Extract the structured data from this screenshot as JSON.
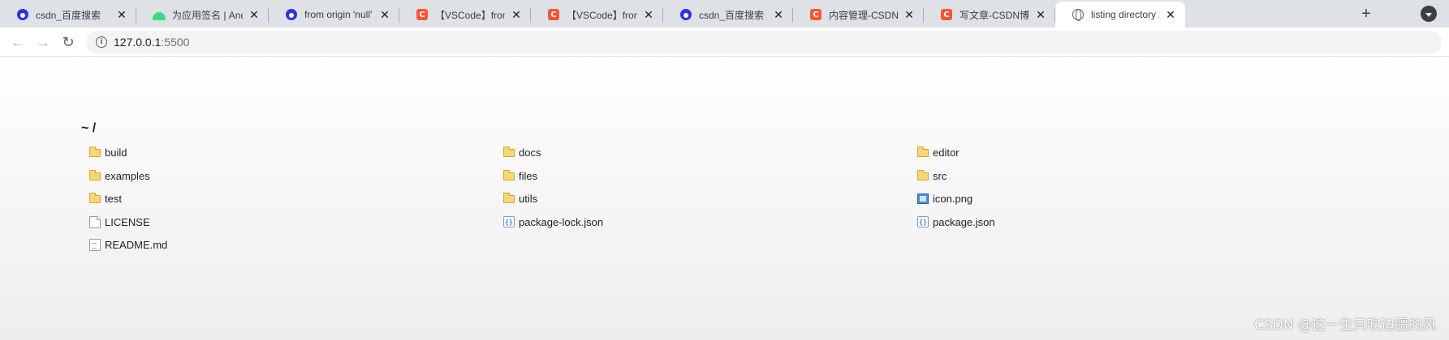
{
  "tabs": [
    {
      "title": "csdn_百度搜索",
      "icon": "baidu-icon"
    },
    {
      "title": "为应用签名 | Android",
      "icon": "android-icon"
    },
    {
      "title": "from origin 'null' has",
      "icon": "baidu-icon"
    },
    {
      "title": "【VSCode】from origin",
      "icon": "csdn-icon"
    },
    {
      "title": "【VSCode】from orig",
      "icon": "csdn-icon"
    },
    {
      "title": "csdn_百度搜索",
      "icon": "baidu-icon"
    },
    {
      "title": "内容管理-CSDN博客",
      "icon": "csdn-icon"
    },
    {
      "title": "写文章-CSDN博客",
      "icon": "csdn-icon"
    },
    {
      "title": "listing directory /",
      "icon": "globe-icon",
      "active": true
    }
  ],
  "tab_close_glyph": "✕",
  "new_tab_glyph": "+",
  "csdn_icon_letter": "C",
  "toolbar": {
    "back_glyph": "←",
    "forward_glyph": "→",
    "reload_glyph": "↻",
    "info_glyph": "i",
    "url_host": "127.0.0.1",
    "url_port": ":5500"
  },
  "listing": {
    "heading": "~ /",
    "columns": [
      [
        {
          "name": "build",
          "type": "folder"
        },
        {
          "name": "examples",
          "type": "folder"
        },
        {
          "name": "test",
          "type": "folder"
        },
        {
          "name": "LICENSE",
          "type": "file"
        },
        {
          "name": "README.md",
          "type": "text"
        }
      ],
      [
        {
          "name": "docs",
          "type": "folder"
        },
        {
          "name": "files",
          "type": "folder"
        },
        {
          "name": "utils",
          "type": "folder"
        },
        {
          "name": "package-lock.json",
          "type": "code"
        }
      ],
      [
        {
          "name": "editor",
          "type": "folder"
        },
        {
          "name": "src",
          "type": "folder"
        },
        {
          "name": "icon.png",
          "type": "image"
        },
        {
          "name": "package.json",
          "type": "code"
        }
      ]
    ]
  },
  "watermark": "CSDN @这一生只吹边疆的风"
}
